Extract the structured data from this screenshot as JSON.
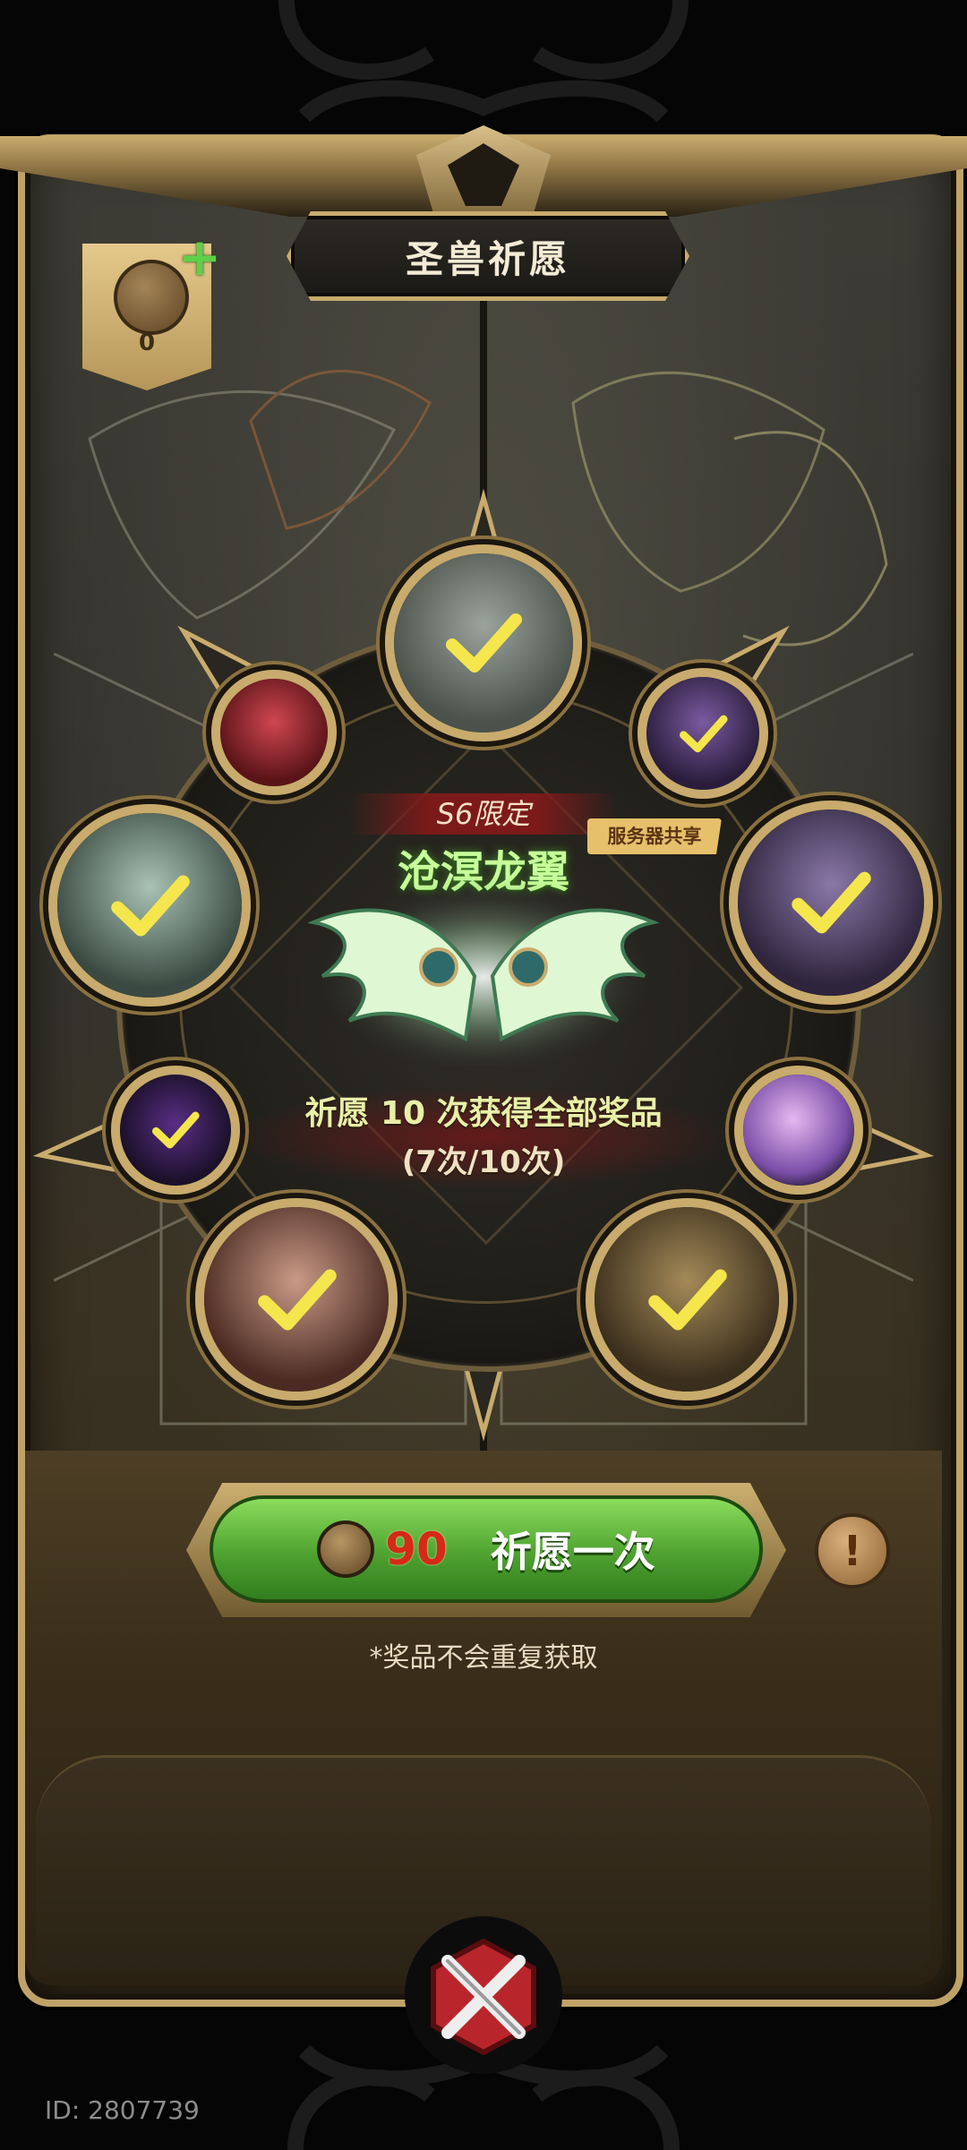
{
  "header": {
    "title": "圣兽祈愿"
  },
  "currency": {
    "count": "0",
    "icon": "prayer-coin-icon",
    "add_icon": "plus-icon"
  },
  "featured": {
    "limited_tag": "S6限定",
    "name": "沧溟龙翼",
    "server_tag": "服务器共享"
  },
  "progress": {
    "text": "祈愿 10 次获得全部奖品",
    "count": "(7次/10次)",
    "current": 7,
    "total": 10
  },
  "prizes": [
    {
      "name": "hero-silver-hair",
      "obtained": true,
      "color": "#6f7a74"
    },
    {
      "name": "card-purple",
      "obtained": true,
      "color": "#5a3f7a"
    },
    {
      "name": "hero-shadow-beast",
      "obtained": true,
      "color": "#5c4a6e"
    },
    {
      "name": "card-pink-star",
      "obtained": false,
      "color": "#b08ad6"
    },
    {
      "name": "hero-lion-mane",
      "obtained": true,
      "color": "#6e5a3a"
    },
    {
      "name": "hero-red-hair",
      "obtained": true,
      "color": "#7a4a3e"
    },
    {
      "name": "emblem-void",
      "obtained": true,
      "color": "#3a2350"
    },
    {
      "name": "hero-jade-dragon",
      "obtained": true,
      "color": "#5e7a6c"
    },
    {
      "name": "hero-crimson-demon",
      "obtained": false,
      "color": "#9a2a30"
    }
  ],
  "action": {
    "cost": "90",
    "label": "祈愿一次",
    "info_icon": "info-icon"
  },
  "note": "*奖品不会重复获取",
  "footer": {
    "id": "ID: 2807739"
  },
  "colors": {
    "gold": "#c8ab6d",
    "green": "#4ea22f",
    "cost_red": "#d52a16"
  }
}
